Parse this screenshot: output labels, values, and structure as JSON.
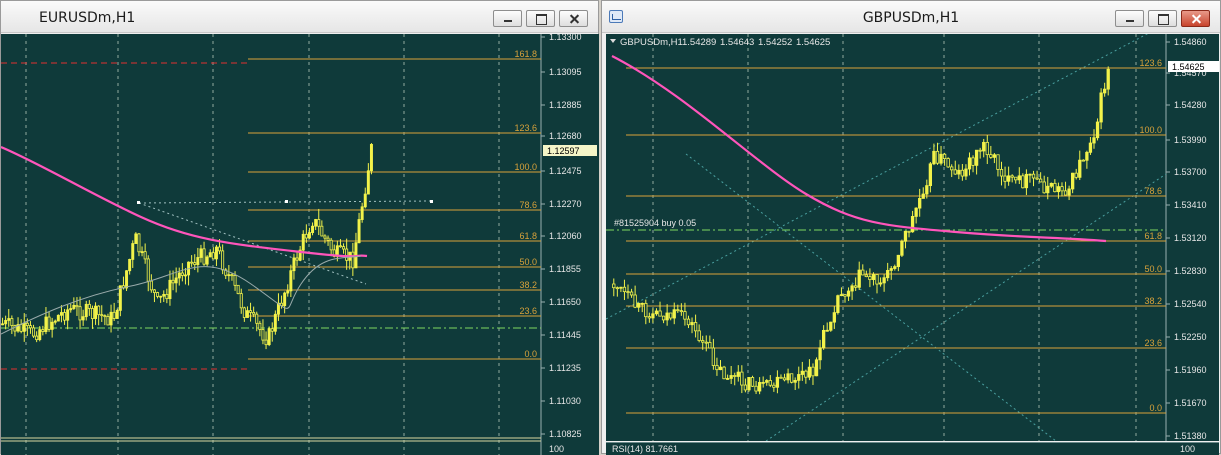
{
  "left": {
    "title": "EURUSDm,H1",
    "buttons": {
      "minimize": "minimize",
      "maximize": "maximize",
      "close": "close"
    },
    "price_axis": [
      "1.13300",
      "1.13095",
      "1.12885",
      "1.12680",
      "1.12475",
      "1.12270",
      "1.12060",
      "1.11855",
      "1.11650",
      "1.11445",
      "1.11235",
      "1.11030",
      "1.10825"
    ],
    "current_price": "1.12597",
    "fib_levels": [
      "161.8",
      "123.6",
      "100.0",
      "78.6",
      "61.8",
      "50.0",
      "38.2",
      "23.6",
      "0.0"
    ],
    "axis_bottom": "100"
  },
  "right": {
    "title": "GBPUSDm,H1",
    "header_symbol": "GBPUSDm,H1",
    "ohlc": [
      "1.54289",
      "1.54643",
      "1.54252",
      "1.54625"
    ],
    "price_axis": [
      "1.54860",
      "1.54570",
      "1.54280",
      "1.53990",
      "1.53700",
      "1.53410",
      "1.53120",
      "1.52830",
      "1.52540",
      "1.52250",
      "1.51960",
      "1.51670",
      "1.51380"
    ],
    "current_price": "1.54625",
    "fib_levels": [
      "123.6",
      "100.0",
      "78.6",
      "61.8",
      "50.0",
      "38.2",
      "23.6",
      "0.0"
    ],
    "order_label": "#81525904 buy 0.05",
    "rsi_label": "RSI(14) 81.7661",
    "rsi_axis": "100"
  },
  "colors": {
    "chart_bg": "#0f3a3a",
    "candle": "#f2f24a",
    "fib": "#d8a23a",
    "ma": "#ff55bb",
    "axis_text": "#e6e6e6",
    "grid": "#c8d8c8"
  }
}
